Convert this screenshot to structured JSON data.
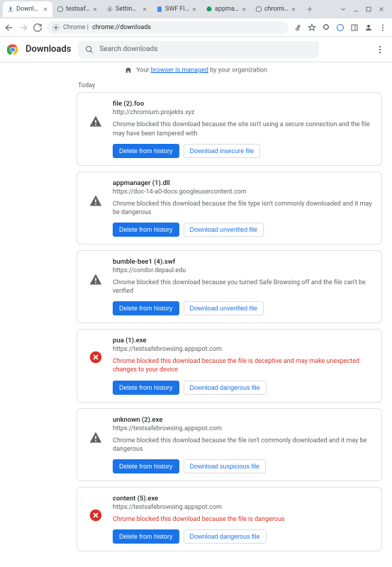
{
  "tabs": [
    {
      "title": "Downloads"
    },
    {
      "title": "testsafebro"
    },
    {
      "title": "Settings - s"
    },
    {
      "title": "SWF File D"
    },
    {
      "title": "appmanag"
    },
    {
      "title": "chromium-"
    }
  ],
  "omnibox": {
    "prefix": "Chrome |",
    "path": "chrome://downloads"
  },
  "header": {
    "title": "Downloads",
    "search_placeholder": "Search downloads"
  },
  "managed": {
    "prefix": "Your ",
    "link": "browser is managed",
    "suffix": " by your organization"
  },
  "section": "Today",
  "actions": {
    "delete": "Delete from history"
  },
  "downloads": [
    {
      "filename": "file (2).foo",
      "url": "http://chromium.projekts.xyz",
      "message": "Chrome blocked this download because the site isn't using a secure connection and the file may have been tampered with",
      "danger": false,
      "icon": "warn",
      "secondary_label": "Download insecure file"
    },
    {
      "filename": "appmanager (1).dll",
      "url": "https://doc-14-a0-docs.googleusercontent.com",
      "message": "Chrome blocked this download because the file type isn't commonly downloaded and it may be dangerous",
      "danger": false,
      "icon": "warn",
      "secondary_label": "Download unverified file"
    },
    {
      "filename": "bumble-bee1 (4).swf",
      "url": "https://condor.depaul.edu",
      "message": "Chrome blocked this download because you turned Safe Browsing off and the file can't be verified",
      "danger": false,
      "icon": "warn",
      "secondary_label": "Download unverified file"
    },
    {
      "filename": "pua (1).exe",
      "url": "https://testsafebrowsing.appspot.com",
      "message": "Chrome blocked this download because the file is deceptive and may make unexpected changes to your device",
      "danger": true,
      "icon": "danger",
      "secondary_label": "Download dangerous file"
    },
    {
      "filename": "unknown (2).exe",
      "url": "https://testsafebrowsing.appspot.com",
      "message": "Chrome blocked this download because the file isn't commonly downloaded and it may be dangerous",
      "danger": false,
      "icon": "warn",
      "secondary_label": "Download suspicious file"
    },
    {
      "filename": "content (5).exe",
      "url": "https://testsafebrowsing.appspot.com",
      "message": "Chrome blocked this download because the file is dangerous",
      "danger": true,
      "icon": "danger",
      "secondary_label": "Download dangerous file"
    }
  ]
}
